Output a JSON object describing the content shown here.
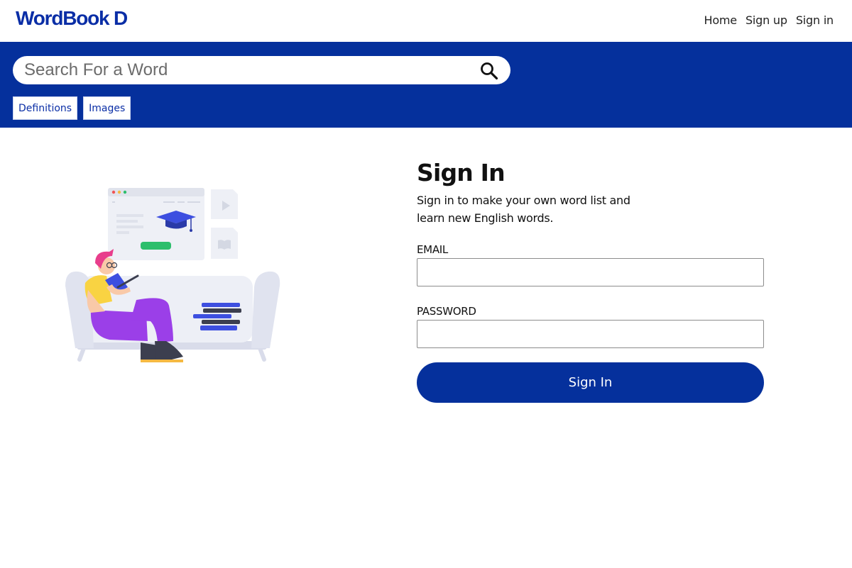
{
  "header": {
    "logo": "WordBook D",
    "nav": [
      {
        "label": "Home"
      },
      {
        "label": "Sign up"
      },
      {
        "label": "Sign in"
      }
    ]
  },
  "search": {
    "placeholder": "Search For a Word",
    "icon": "search-icon",
    "tabs": [
      {
        "label": "Definitions"
      },
      {
        "label": "Images"
      }
    ]
  },
  "signin": {
    "title": "Sign In",
    "subtitle": "Sign in to make your own word list and learn new English words.",
    "email_label": "EMAIL",
    "password_label": "PASSWORD",
    "submit_label": "Sign In"
  },
  "colors": {
    "brand_blue": "#05309c",
    "logo_blue": "#0a2ea6",
    "illustration_purple": "#9b3fe8",
    "illustration_green": "#2dbe6c"
  }
}
